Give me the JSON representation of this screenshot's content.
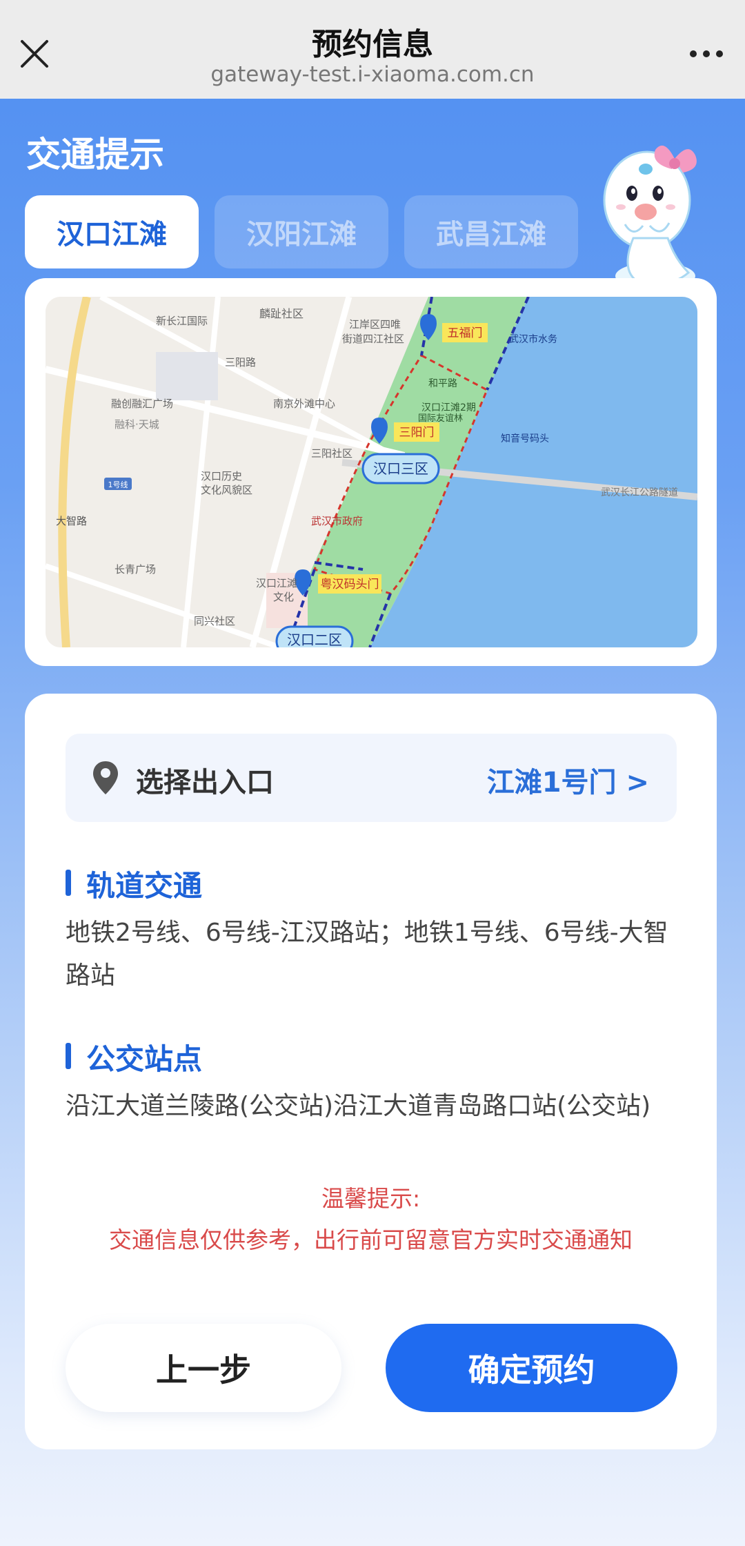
{
  "topbar": {
    "title": "预约信息",
    "url": "gateway-test.i-xiaoma.com.cn"
  },
  "header": {
    "section_title": "交通提示",
    "tabs": [
      {
        "label": "汉口江滩",
        "active": true
      },
      {
        "label": "汉阳江滩",
        "active": false
      },
      {
        "label": "武昌江滩",
        "active": false
      }
    ]
  },
  "map": {
    "labels": {
      "xinchangjiang": "新长江国际",
      "linzhi": "麟趾社区",
      "jiangan": "江岸区四唯",
      "jiangshe": "街道四江社区",
      "sanyanglu": "三阳路",
      "rongchuang": "融创融汇广场",
      "rongke": "融科·天城",
      "nanjing": "南京外滩中心",
      "sanyangshequ": "三阳社区",
      "hankoulishi": "汉口历史",
      "wenhuafengmao": "文化风貌区",
      "dazhilu": "大智路",
      "changqing": "长青广场",
      "zhengfu": "武汉市政府",
      "hankoujiangtan": "汉口江滩",
      "wenhua": "文化",
      "tongxing": "同兴社区",
      "hepinglu": "和平路",
      "hankoujiangtan2": "汉口江滩2期",
      "guoji": "国际友谊林",
      "wuhanhaiguan": "武汉市水务",
      "zhidu": "知音号码头",
      "tunnel": "武汉长江公路隧道",
      "zone3": "汉口三区",
      "zone2": "汉口二区",
      "gate5": "五福门",
      "gate3": "三阳门",
      "gateYue": "粤汉码头门",
      "station": "1号线"
    }
  },
  "info": {
    "entry_label": "选择出入口",
    "entry_value": "江滩1号门 >",
    "rail_title": "轨道交通",
    "rail_text": "地铁2号线、6号线-江汉路站；地铁1号线、6号线-大智路站",
    "bus_title": "公交站点",
    "bus_text": "沿江大道兰陵路(公交站)沿江大道青岛路口站(公交站)",
    "tip_title": "温馨提示:",
    "tip_text": "交通信息仅供参考，出行前可留意官方实时交通通知",
    "prev_label": "上一步",
    "confirm_label": "确定预约"
  },
  "colors": {
    "accent": "#1f6bf0",
    "tip_red": "#d94a4a",
    "header_blue": "#4f8ef2"
  }
}
